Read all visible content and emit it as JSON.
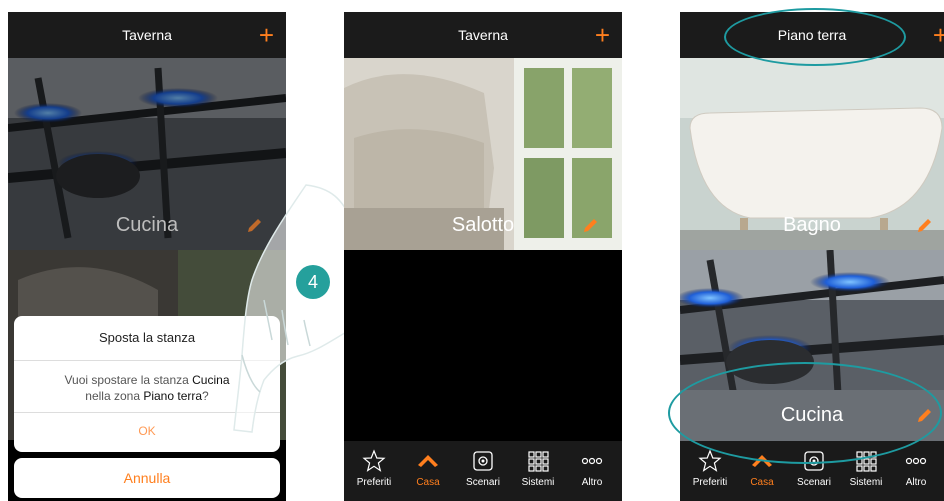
{
  "screens": [
    {
      "header_title": "Taverna",
      "rooms": [
        "Cucina"
      ],
      "dialog": {
        "title": "Sposta la stanza",
        "message_prefix": "Vuoi spostare la stanza ",
        "room": "Cucina",
        "message_middle": "nella zona ",
        "zone": "Piano terra",
        "message_suffix": "?",
        "ok_label": "OK",
        "cancel_label": "Annulla"
      },
      "step_number": "4"
    },
    {
      "header_title": "Taverna",
      "rooms": [
        "Salotto"
      ]
    },
    {
      "header_title": "Piano terra",
      "rooms": [
        "Bagno",
        "Cucina"
      ]
    }
  ],
  "tabbar": {
    "items": [
      {
        "label": "Preferiti",
        "icon": "star-icon"
      },
      {
        "label": "Casa",
        "icon": "house-icon",
        "active": true
      },
      {
        "label": "Scenari",
        "icon": "scenario-icon"
      },
      {
        "label": "Sistemi",
        "icon": "grid-icon"
      },
      {
        "label": "Altro",
        "icon": "more-icon"
      }
    ]
  },
  "colors": {
    "accent": "#ff7f1e",
    "highlight": "#1e9ba1",
    "step_badge": "#25a09c"
  }
}
